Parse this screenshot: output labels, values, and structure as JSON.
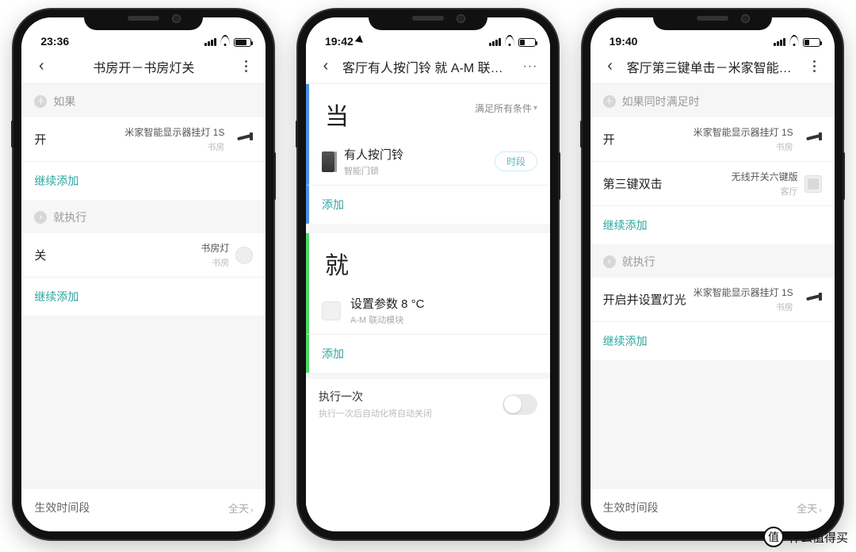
{
  "watermark": "什么值得买",
  "watermark_badge": "值",
  "phones": [
    {
      "time": "23:36",
      "show_location": false,
      "battery_low": false,
      "title": "书房开－书房灯关",
      "more_style": "v",
      "style": "mijia",
      "if_label": "如果",
      "then_label": "就执行",
      "if_rows": [
        {
          "left_title": "开",
          "right_title": "米家智能显示器挂灯 1S",
          "right_sub": "书房",
          "right_icon": "lamp"
        }
      ],
      "if_add": "继续添加",
      "then_rows": [
        {
          "left_title": "关",
          "right_title": "书房灯",
          "right_sub": "书房",
          "right_icon": "toggle"
        }
      ],
      "then_add": "继续添加",
      "footer_label": "生效时间段",
      "footer_value": "全天"
    },
    {
      "time": "19:42",
      "show_location": true,
      "battery_low": true,
      "title": "客厅有人按门铃 就 A-M 联动模块",
      "more_style": "h",
      "style": "aqara",
      "when_char": "当",
      "when_sub": "满足所有条件",
      "when_rows": [
        {
          "icon": "door",
          "left_title": "有人按门铃",
          "left_sub": "智能门锁",
          "pill": "时段"
        }
      ],
      "when_add": "添加",
      "do_char": "就",
      "do_rows": [
        {
          "icon": "module",
          "left_title": "设置参数 8 °C",
          "left_sub": "A-M 联动模块"
        }
      ],
      "do_add": "添加",
      "runonce_title": "执行一次",
      "runonce_sub": "执行一次后自动化将自动关闭"
    },
    {
      "time": "19:40",
      "show_location": false,
      "battery_low": true,
      "title": "客厅第三键单击－米家智能显示…",
      "more_style": "v",
      "style": "mijia",
      "if_label": "如果同时满足时",
      "then_label": "就执行",
      "if_rows": [
        {
          "left_title": "开",
          "right_title": "米家智能显示器挂灯 1S",
          "right_sub": "书房",
          "right_icon": "lamp"
        },
        {
          "left_title": "第三键双击",
          "right_title": "无线开关六键版",
          "right_sub": "客厅",
          "right_icon": "switch"
        }
      ],
      "if_add": "继续添加",
      "then_rows": [
        {
          "left_title": "开启并设置灯光",
          "right_title": "米家智能显示器挂灯 1S",
          "right_sub": "书房",
          "right_icon": "lamp"
        }
      ],
      "then_add": "继续添加",
      "footer_label": "生效时间段",
      "footer_value": "全天"
    }
  ]
}
